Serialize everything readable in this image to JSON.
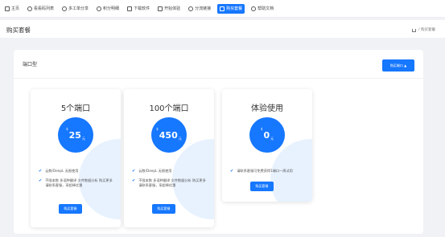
{
  "nav": [
    {
      "label": "主页",
      "icon": "home-icon",
      "active": false
    },
    {
      "label": "看看码列表",
      "icon": "bulb-icon",
      "active": false
    },
    {
      "label": "多工单分享",
      "icon": "user-icon",
      "active": false
    },
    {
      "label": "积分明细",
      "icon": "users-icon",
      "active": false
    },
    {
      "label": "下载软件",
      "icon": "download-icon",
      "active": false
    },
    {
      "label": "开始体验",
      "icon": "swap-icon",
      "active": false
    },
    {
      "label": "分流链接",
      "icon": "share-icon",
      "active": false
    },
    {
      "label": "购买套餐",
      "icon": "cart-icon",
      "active": true
    },
    {
      "label": "帮助文档",
      "icon": "help-icon",
      "active": false
    }
  ],
  "page_title": "购买套餐",
  "breadcrumb": {
    "current": "/ 购买套餐"
  },
  "panel": {
    "title": "端口型",
    "buy_port_label": "购买端口 ▲"
  },
  "cards": [
    {
      "title": "5个端口",
      "currency": "$",
      "price": "25",
      "unit": "元",
      "features": [
        "云数/DeepL 无限使用",
        "不限本数 多语种翻译 文件数据分析 购买更多请联系客服，享超棒优惠"
      ],
      "button": "购买套餐"
    },
    {
      "title": "100个端口",
      "currency": "$",
      "price": "450",
      "unit": "元",
      "features": [
        "云数/DeepL 无限使用",
        "不限本数 多语种翻译 文件数据分析 购买更多请联系客服，享超棒优惠"
      ],
      "button": "购买套餐"
    },
    {
      "title": "体验使用",
      "currency": "$",
      "price": "0",
      "unit": "元",
      "features": [
        "请联系客服可免费获得1端口一周试用"
      ],
      "button": "购买套餐"
    }
  ],
  "colors": {
    "accent": "#1677ff",
    "deco": "#e8f2ff",
    "background": "#f0f2f5"
  }
}
